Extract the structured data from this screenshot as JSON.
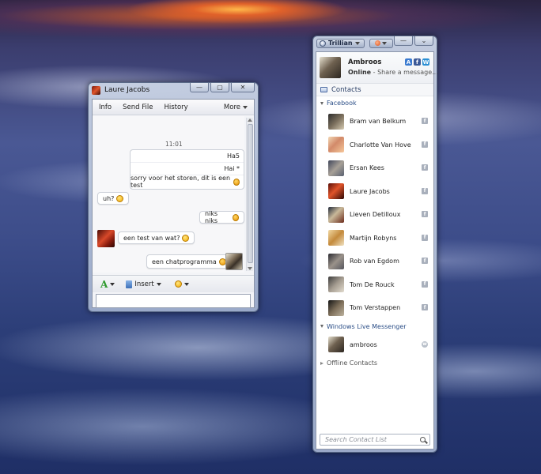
{
  "chat_window": {
    "title": "Laure Jacobs",
    "controls": {
      "minimize": "—",
      "maximize": "▢",
      "close": "✕"
    },
    "menu": {
      "info": "Info",
      "send_file": "Send File",
      "history": "History",
      "more": "More"
    },
    "timestamp": "11:01",
    "outgoing_block": [
      "Ha5",
      "Hai *",
      "sorry voor het storen, dit is een test"
    ],
    "messages": {
      "m1": "uh?",
      "m2": "niks niks",
      "m3": "een test van wat?",
      "m4": "een chatprogramma"
    },
    "toolbar": {
      "font": "A",
      "insert": "Insert"
    },
    "input_value": ""
  },
  "contact_window": {
    "app_name": "Trillian",
    "controls": {
      "minimize": "—",
      "menu": "⌄"
    },
    "profile": {
      "name": "Ambroos",
      "status": "Online",
      "message": " - Share a message..."
    },
    "network_icons": {
      "a": "A",
      "f": "f",
      "w": "W"
    },
    "contacts_label": "Contacts",
    "groups": {
      "facebook": {
        "label": "Facebook",
        "contacts": [
          {
            "name": "Bram van Belkum",
            "network": "f"
          },
          {
            "name": "Charlotte Van Hove",
            "network": "f"
          },
          {
            "name": "Ersan Kees",
            "network": "f"
          },
          {
            "name": "Laure Jacobs",
            "network": "f"
          },
          {
            "name": "Lieven Detilloux",
            "network": "f"
          },
          {
            "name": "Martijn Robyns",
            "network": "f"
          },
          {
            "name": "Rob van Egdom",
            "network": "f"
          },
          {
            "name": "Tom De Rouck",
            "network": "f"
          },
          {
            "name": "Tom Verstappen",
            "network": "f"
          }
        ]
      },
      "wlm": {
        "label": "Windows Live Messenger",
        "contacts": [
          {
            "name": "ambroos",
            "network": "w"
          }
        ]
      },
      "offline": {
        "label": "Offline Contacts"
      }
    },
    "search_placeholder": "Search Contact List"
  }
}
